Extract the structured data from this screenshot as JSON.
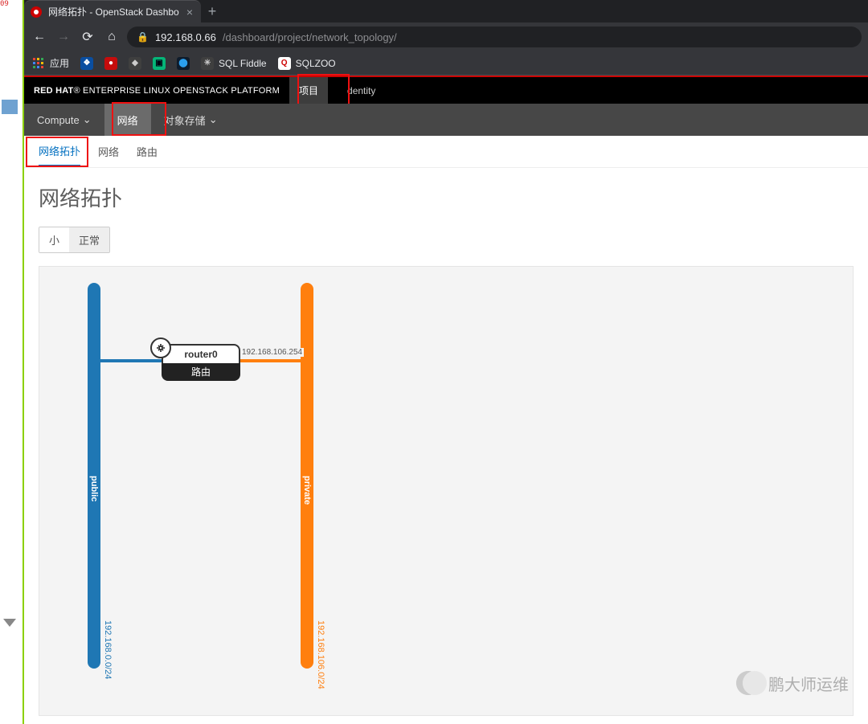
{
  "gutter": {
    "badge": "09"
  },
  "browser": {
    "tab_title": "网络拓扑 - OpenStack Dashbo",
    "url_host": "192.168.0.66",
    "url_path": "/dashboard/project/network_topology/",
    "bookmarks": {
      "apps": "应用",
      "sqlfiddle": "SQL Fiddle",
      "sqlzoo": "SQLZOO"
    }
  },
  "topbar": {
    "brand_prefix": "RED HAT",
    "brand_rest": "ENTERPRISE LINUX OPENSTACK PLATFORM",
    "tab_project": "项目",
    "tab_identity": "dentity"
  },
  "secnav": {
    "compute": "Compute",
    "network": "网络",
    "object": "对象存储"
  },
  "ternav": {
    "topology": "网络拓扑",
    "networks": "网络",
    "routers": "路由"
  },
  "page": {
    "title": "网络拓扑",
    "size_small": "小",
    "size_normal": "正常"
  },
  "topology": {
    "networks": {
      "public": {
        "name": "public",
        "cidr": "192.168.0.0/24",
        "color": "#1f77b4"
      },
      "private": {
        "name": "private",
        "cidr": "192.168.106.0/24",
        "color": "#ff7f0e"
      }
    },
    "router": {
      "name": "router0",
      "type": "路由",
      "port_ip": "192.168.106.254"
    }
  },
  "watermark": "鹏大师运维"
}
